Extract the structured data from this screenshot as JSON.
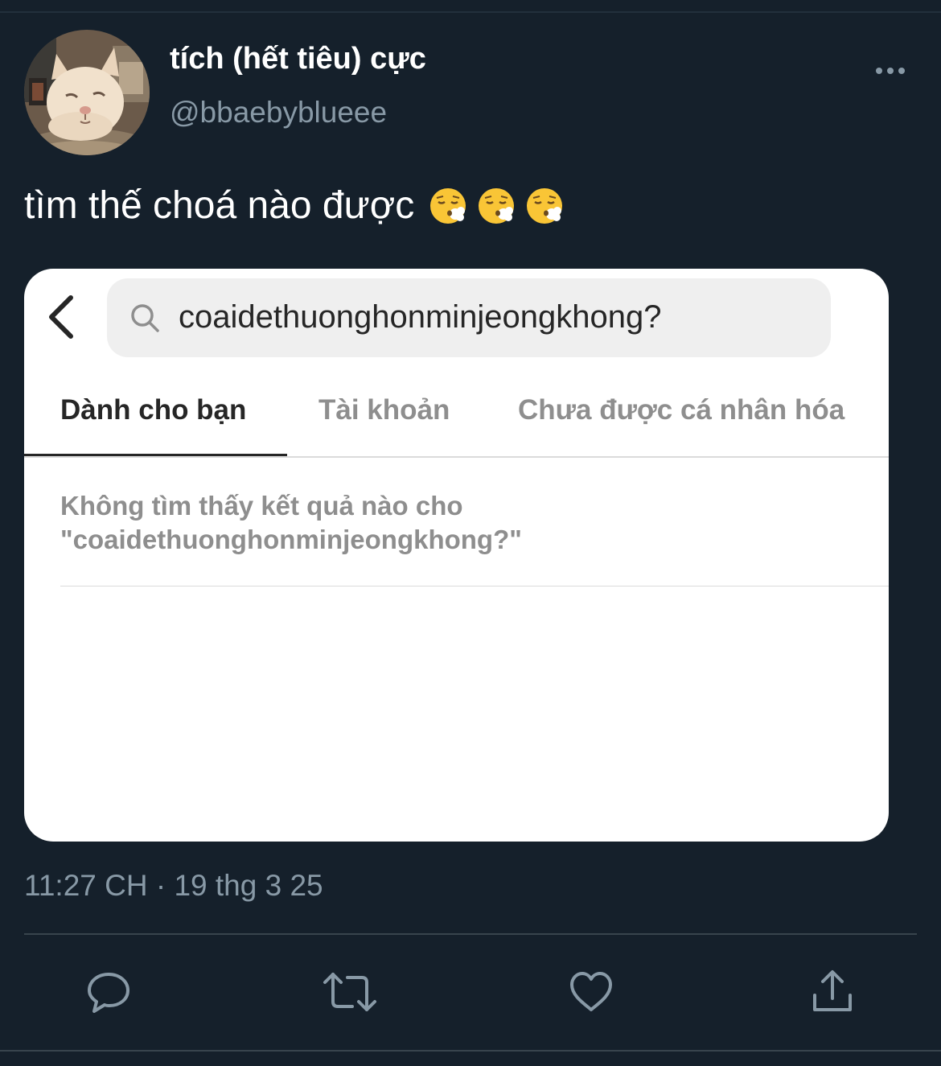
{
  "tweet": {
    "display_name": "tích (hết tiêu) cực",
    "handle": "@bbaebyblueee",
    "text": "tìm thế choá nào được",
    "emojis": [
      "face-exhaling-emoji",
      "face-exhaling-emoji",
      "face-exhaling-emoji"
    ],
    "timestamp": "11:27 CH · 19 thg 3 25"
  },
  "embedded_screenshot": {
    "search_query": "coaidethuonghonminjeongkhong?",
    "tabs": [
      {
        "label": "Dành cho bạn",
        "active": true
      },
      {
        "label": "Tài khoản",
        "active": false
      },
      {
        "label": "Chưa được cá nhân hóa",
        "active": false
      }
    ],
    "empty_message": {
      "line1": "Không tìm thấy kết quả nào cho",
      "line2": "\"coaidethuonghonminjeongkhong?\""
    }
  },
  "actions": [
    "reply-icon",
    "retweet-icon",
    "like-icon",
    "share-icon"
  ],
  "colors": {
    "background": "#15202b",
    "secondary_text": "#8899a6",
    "divider": "#38444d",
    "card_background": "#ffffff"
  }
}
